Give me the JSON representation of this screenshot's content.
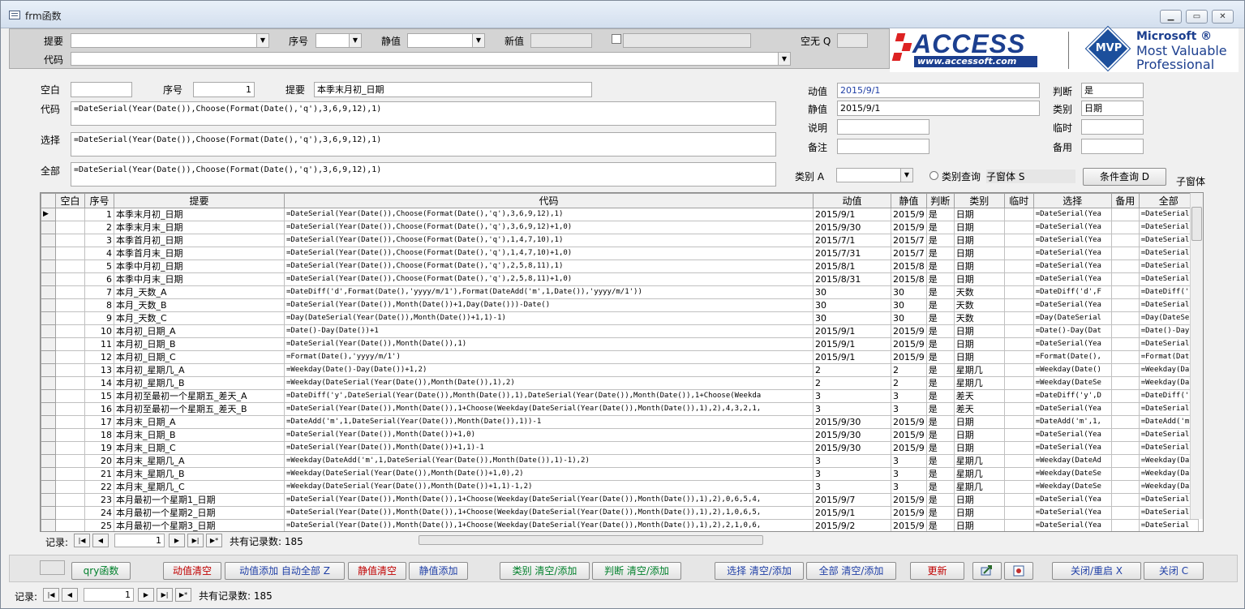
{
  "window": {
    "title": "frm函数",
    "min": "▁",
    "max": "▭",
    "close": "✕"
  },
  "header": {
    "tiyao_label": "提要",
    "xuhao_label": "序号",
    "jingzhi_label": "静值",
    "xinzhi_label": "新值",
    "kongwu_label": "空无 Q",
    "daima_label": "代码"
  },
  "logo": {
    "access": "ACCESS",
    "site": "www.accessoft.com",
    "mvp": "MVP",
    "ms1": "Microsoft ®",
    "ms2": "Most Valuable",
    "ms3": "Professional"
  },
  "detail": {
    "kongbai_label": "空白",
    "kongbai_value": "",
    "xuhao_label": "序号",
    "xuhao_value": "1",
    "tiyao_label": "提要",
    "tiyao_value": "本季末月初_日期",
    "daima_label": "代码",
    "daima_value": "=DateSerial(Year(Date()),Choose(Format(Date(),'q'),3,6,9,12),1)",
    "xuanze_label": "选择",
    "xuanze_value": "=DateSerial(Year(Date()),Choose(Format(Date(),'q'),3,6,9,12),1)",
    "quanbu_label": "全部",
    "quanbu_value": "=DateSerial(Year(Date()),Choose(Format(Date(),'q'),3,6,9,12),1)",
    "dongzhi_label": "动值",
    "dongzhi_value": "2015/9/1",
    "jingzhi_label": "静值",
    "jingzhi_value": "2015/9/1",
    "shuoming_label": "说明",
    "beizhu_label": "备注",
    "panduan_label": "判断",
    "panduan_value": "是",
    "leibie_label": "类别",
    "leibie_value": "日期",
    "linshi_label": "临时",
    "beiyong_label": "备用",
    "leibie_a_label": "类别 A",
    "leibie_query": "类别查询",
    "zichuangti_s": "子窗体 S",
    "tiaojian_button": "条件查询 D",
    "zichuangti": "子窗体"
  },
  "grid": {
    "columns": [
      "空白",
      "序号",
      "提要",
      "代码",
      "动值",
      "静值",
      "判断",
      "类别",
      "临时",
      "选择",
      "备用",
      "全部"
    ],
    "rows": [
      [
        "",
        "1",
        "本季末月初_日期",
        "=DateSerial(Year(Date()),Choose(Format(Date(),'q'),3,6,9,12),1)",
        "2015/9/1",
        "2015/9",
        "是",
        "日期",
        "",
        "=DateSerial(Yea",
        "",
        "=DateSerial"
      ],
      [
        "",
        "2",
        "本季末月末_日期",
        "=DateSerial(Year(Date()),Choose(Format(Date(),'q'),3,6,9,12)+1,0)",
        "2015/9/30",
        "2015/9",
        "是",
        "日期",
        "",
        "=DateSerial(Yea",
        "",
        "=DateSerial"
      ],
      [
        "",
        "3",
        "本季首月初_日期",
        "=DateSerial(Year(Date()),Choose(Format(Date(),'q'),1,4,7,10),1)",
        "2015/7/1",
        "2015/7",
        "是",
        "日期",
        "",
        "=DateSerial(Yea",
        "",
        "=DateSerial"
      ],
      [
        "",
        "4",
        "本季首月末_日期",
        "=DateSerial(Year(Date()),Choose(Format(Date(),'q'),1,4,7,10)+1,0)",
        "2015/7/31",
        "2015/7",
        "是",
        "日期",
        "",
        "=DateSerial(Yea",
        "",
        "=DateSerial"
      ],
      [
        "",
        "5",
        "本季中月初_日期",
        "=DateSerial(Year(Date()),Choose(Format(Date(),'q'),2,5,8,11),1)",
        "2015/8/1",
        "2015/8",
        "是",
        "日期",
        "",
        "=DateSerial(Yea",
        "",
        "=DateSerial"
      ],
      [
        "",
        "6",
        "本季中月末_日期",
        "=DateSerial(Year(Date()),Choose(Format(Date(),'q'),2,5,8,11)+1,0)",
        "2015/8/31",
        "2015/8",
        "是",
        "日期",
        "",
        "=DateSerial(Yea",
        "",
        "=DateSerial"
      ],
      [
        "",
        "7",
        "本月_天数_A",
        "=DateDiff('d',Format(Date(),'yyyy/m/1'),Format(DateAdd('m',1,Date()),'yyyy/m/1'))",
        "30",
        "30",
        "是",
        "天数",
        "",
        "=DateDiff('d',F",
        "",
        "=DateDiff('"
      ],
      [
        "",
        "8",
        "本月_天数_B",
        "=DateSerial(Year(Date()),Month(Date())+1,Day(Date()))-Date()",
        "30",
        "30",
        "是",
        "天数",
        "",
        "=DateSerial(Yea",
        "",
        "=DateSerial"
      ],
      [
        "",
        "9",
        "本月_天数_C",
        "=Day(DateSerial(Year(Date()),Month(Date())+1,1)-1)",
        "30",
        "30",
        "是",
        "天数",
        "",
        "=Day(DateSerial",
        "",
        "=Day(DateSe"
      ],
      [
        "",
        "10",
        "本月初_日期_A",
        "=Date()-Day(Date())+1",
        "2015/9/1",
        "2015/9",
        "是",
        "日期",
        "",
        "=Date()-Day(Dat",
        "",
        "=Date()-Day"
      ],
      [
        "",
        "11",
        "本月初_日期_B",
        "=DateSerial(Year(Date()),Month(Date()),1)",
        "2015/9/1",
        "2015/9",
        "是",
        "日期",
        "",
        "=DateSerial(Yea",
        "",
        "=DateSerial"
      ],
      [
        "",
        "12",
        "本月初_日期_C",
        "=Format(Date(),'yyyy/m/1')",
        "2015/9/1",
        "2015/9",
        "是",
        "日期",
        "",
        "=Format(Date(),",
        "",
        "=Format(Dat"
      ],
      [
        "",
        "13",
        "本月初_星期几_A",
        "=Weekday(Date()-Day(Date())+1,2)",
        "2",
        "2",
        "是",
        "星期几",
        "",
        "=Weekday(Date()",
        "",
        "=Weekday(Da"
      ],
      [
        "",
        "14",
        "本月初_星期几_B",
        "=Weekday(DateSerial(Year(Date()),Month(Date()),1),2)",
        "2",
        "2",
        "是",
        "星期几",
        "",
        "=Weekday(DateSe",
        "",
        "=Weekday(Da"
      ],
      [
        "",
        "15",
        "本月初至最初一个星期五_差天_A",
        "=DateDiff('y',DateSerial(Year(Date()),Month(Date()),1),DateSerial(Year(Date()),Month(Date()),1+Choose(Weekda",
        "3",
        "3",
        "是",
        "差天",
        "",
        "=DateDiff('y',D",
        "",
        "=DateDiff('"
      ],
      [
        "",
        "16",
        "本月初至最初一个星期五_差天_B",
        "=DateSerial(Year(Date()),Month(Date()),1+Choose(Weekday(DateSerial(Year(Date()),Month(Date()),1),2),4,3,2,1,",
        "3",
        "3",
        "是",
        "差天",
        "",
        "=DateSerial(Yea",
        "",
        "=DateSerial"
      ],
      [
        "",
        "17",
        "本月末_日期_A",
        "=DateAdd('m',1,DateSerial(Year(Date()),Month(Date()),1))-1",
        "2015/9/30",
        "2015/9",
        "是",
        "日期",
        "",
        "=DateAdd('m',1,",
        "",
        "=DateAdd('m'"
      ],
      [
        "",
        "18",
        "本月末_日期_B",
        "=DateSerial(Year(Date()),Month(Date())+1,0)",
        "2015/9/30",
        "2015/9",
        "是",
        "日期",
        "",
        "=DateSerial(Yea",
        "",
        "=DateSerial"
      ],
      [
        "",
        "19",
        "本月末_日期_C",
        "=DateSerial(Year(Date()),Month(Date())+1,1)-1",
        "2015/9/30",
        "2015/9",
        "是",
        "日期",
        "",
        "=DateSerial(Yea",
        "",
        "=DateSerial"
      ],
      [
        "",
        "20",
        "本月末_星期几_A",
        "=Weekday(DateAdd('m',1,DateSerial(Year(Date()),Month(Date()),1)-1),2)",
        "3",
        "3",
        "是",
        "星期几",
        "",
        "=Weekday(DateAd",
        "",
        "=Weekday(Da"
      ],
      [
        "",
        "21",
        "本月末_星期几_B",
        "=Weekday(DateSerial(Year(Date()),Month(Date())+1,0),2)",
        "3",
        "3",
        "是",
        "星期几",
        "",
        "=Weekday(DateSe",
        "",
        "=Weekday(Da"
      ],
      [
        "",
        "22",
        "本月末_星期几_C",
        "=Weekday(DateSerial(Year(Date()),Month(Date())+1,1)-1,2)",
        "3",
        "3",
        "是",
        "星期几",
        "",
        "=Weekday(DateSe",
        "",
        "=Weekday(Da"
      ],
      [
        "",
        "23",
        "本月最初一个星期1_日期",
        "=DateSerial(Year(Date()),Month(Date()),1+Choose(Weekday(DateSerial(Year(Date()),Month(Date()),1),2),0,6,5,4,",
        "2015/9/7",
        "2015/9",
        "是",
        "日期",
        "",
        "=DateSerial(Yea",
        "",
        "=DateSerial"
      ],
      [
        "",
        "24",
        "本月最初一个星期2_日期",
        "=DateSerial(Year(Date()),Month(Date()),1+Choose(Weekday(DateSerial(Year(Date()),Month(Date()),1),2),1,0,6,5,",
        "2015/9/1",
        "2015/9",
        "是",
        "日期",
        "",
        "=DateSerial(Yea",
        "",
        "=DateSerial"
      ],
      [
        "",
        "25",
        "本月最初一个星期3_日期",
        "=DateSerial(Year(Date()),Month(Date()),1+Choose(Weekday(DateSerial(Year(Date()),Month(Date()),1),2),2,1,0,6,",
        "2015/9/2",
        "2015/9",
        "是",
        "日期",
        "",
        "=DateSerial(Yea",
        "",
        "=DateSerial"
      ]
    ]
  },
  "subnav": {
    "label": "记录:",
    "current": "1",
    "total": "共有记录数: 185"
  },
  "buttons": {
    "qry": "qry函数",
    "dz_clear": "动值清空",
    "dz_add": "动值添加 自动全部 Z",
    "jz_clear": "静值清空",
    "jz_add": "静值添加",
    "lb": "类别 清空/添加",
    "pd": "判断 清空/添加",
    "xz": "选择 清空/添加",
    "qb": "全部 清空/添加",
    "update": "更新",
    "close_restart": "关闭/重启 X",
    "close": "关闭 C"
  },
  "mainnav": {
    "label": "记录:",
    "current": "1",
    "total": "共有记录数: 185"
  },
  "colors": {
    "red": "#c00000",
    "green": "#00802b",
    "blue": "#1f3fa6",
    "accent": "#b22222"
  }
}
